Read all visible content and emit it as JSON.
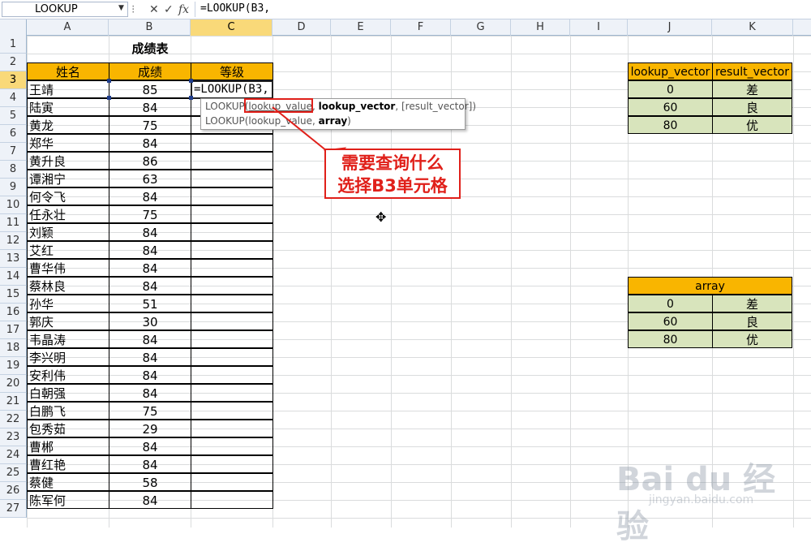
{
  "name_box": "LOOKUP",
  "formula_bar": {
    "cancel_glyph": "✕",
    "enter_glyph": "✓",
    "fx_label": "fx",
    "formula": "=LOOKUP(B3,"
  },
  "columns": [
    "A",
    "B",
    "C",
    "D",
    "E",
    "F",
    "G",
    "H",
    "I",
    "J",
    "K"
  ],
  "active_column": "C",
  "rows": [
    "1",
    "2",
    "3",
    "4",
    "5",
    "6",
    "7",
    "8",
    "9",
    "10",
    "11",
    "12",
    "13",
    "14",
    "15",
    "16",
    "17",
    "18",
    "19",
    "20",
    "21",
    "22",
    "23",
    "24",
    "25",
    "26",
    "27"
  ],
  "active_row": "3",
  "sheet": {
    "title": "成绩表",
    "headers": [
      "姓名",
      "成绩",
      "等级"
    ],
    "records": [
      {
        "name": "王靖",
        "score": "85"
      },
      {
        "name": "陆寅",
        "score": "84"
      },
      {
        "name": "黄龙",
        "score": "75"
      },
      {
        "name": "郑华",
        "score": "84"
      },
      {
        "name": "黄升良",
        "score": "86"
      },
      {
        "name": "谭湘宁",
        "score": "63"
      },
      {
        "name": "何令飞",
        "score": "84"
      },
      {
        "name": "任永壮",
        "score": "75"
      },
      {
        "name": "刘颖",
        "score": "84"
      },
      {
        "name": "艾红",
        "score": "84"
      },
      {
        "name": "曹华伟",
        "score": "84"
      },
      {
        "name": "蔡林良",
        "score": "84"
      },
      {
        "name": "孙华",
        "score": "51"
      },
      {
        "name": "郭庆",
        "score": "30"
      },
      {
        "name": "韦晶涛",
        "score": "84"
      },
      {
        "name": "李兴明",
        "score": "84"
      },
      {
        "name": "安利伟",
        "score": "84"
      },
      {
        "name": "白朝强",
        "score": "84"
      },
      {
        "name": "白鹏飞",
        "score": "75"
      },
      {
        "name": "包秀茹",
        "score": "29"
      },
      {
        "name": "曹郴",
        "score": "84"
      },
      {
        "name": "曹红艳",
        "score": "84"
      },
      {
        "name": "蔡健",
        "score": "58"
      },
      {
        "name": "陈军何",
        "score": "84"
      }
    ],
    "edit_value": "=LOOKUP(B3,"
  },
  "vector_table": {
    "headers": [
      "lookup_vector",
      "result_vector"
    ],
    "rows": [
      [
        "0",
        "差"
      ],
      [
        "60",
        "良"
      ],
      [
        "80",
        "优"
      ]
    ]
  },
  "array_table": {
    "header": "array",
    "rows": [
      [
        "0",
        "差"
      ],
      [
        "60",
        "良"
      ],
      [
        "80",
        "优"
      ]
    ]
  },
  "tooltip": {
    "line1_fn": "LOOKUP(",
    "line1_arg1": "lookup_value",
    "line1_sep1": ", ",
    "line1_arg2": "lookup_vector",
    "line1_rest": ", [result_vector])",
    "line2_fn": "LOOKUP(",
    "line2_arg1": "lookup_value",
    "line2_sep": ", ",
    "line2_arg2": "array",
    "line2_end": ")"
  },
  "callout": {
    "line1": "需要查询什么",
    "line2": "选择B3单元格"
  },
  "watermark": {
    "text": "Bai du 经验",
    "sub": "jingyan.baidu.com"
  },
  "colors": {
    "header_orange": "#f9b500",
    "lookup_green": "#d8e4bc",
    "annotation_red": "#e0201a",
    "active_header": "#f9d979"
  }
}
